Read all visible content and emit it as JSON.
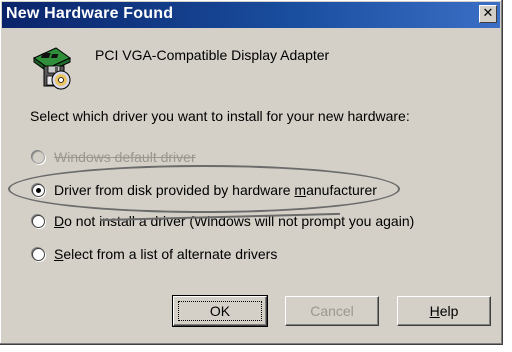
{
  "window": {
    "title": "New Hardware Found",
    "close_glyph": "✕"
  },
  "device": {
    "icon": "hardware-disk-icon",
    "name": "PCI VGA-Compatible Display Adapter"
  },
  "prompt": "Select which driver you want to install for your new hardware:",
  "options": [
    {
      "label": "Windows default driver",
      "selected": false,
      "disabled": true
    },
    {
      "pre": "Driver from disk provided by hardware ",
      "accel": "m",
      "post": "anufacturer",
      "selected": true,
      "disabled": false
    },
    {
      "accel": "D",
      "post": "o not install a driver (Windows will not prompt you again)",
      "selected": false,
      "disabled": false
    },
    {
      "accel": "S",
      "post": "elect from a list of alternate drivers",
      "selected": false,
      "disabled": false
    }
  ],
  "buttons": {
    "ok": "OK",
    "cancel": "Cancel",
    "help": {
      "accel": "H",
      "post": "elp"
    }
  }
}
